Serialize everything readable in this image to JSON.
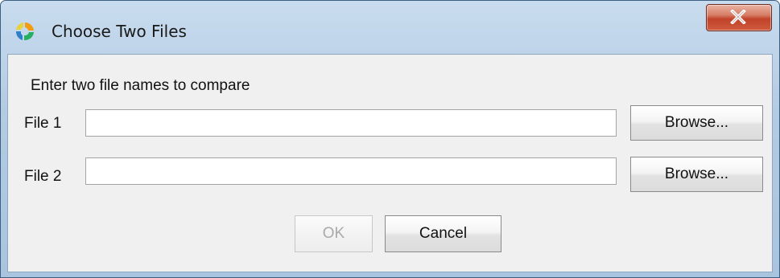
{
  "window": {
    "title": "Choose Two Files",
    "app_icon": "app-logo-icon",
    "close_icon": "close-icon"
  },
  "form": {
    "instruction": "Enter two file names to compare",
    "file1": {
      "label": "File 1",
      "value": "",
      "browse_label": "Browse..."
    },
    "file2": {
      "label": "File 2",
      "value": "",
      "browse_label": "Browse..."
    }
  },
  "buttons": {
    "ok_label": "OK",
    "ok_enabled": false,
    "cancel_label": "Cancel"
  },
  "colors": {
    "titlebar": "#b3cbe3",
    "close_button": "#c1432a",
    "client_background": "#f0f0f0"
  }
}
